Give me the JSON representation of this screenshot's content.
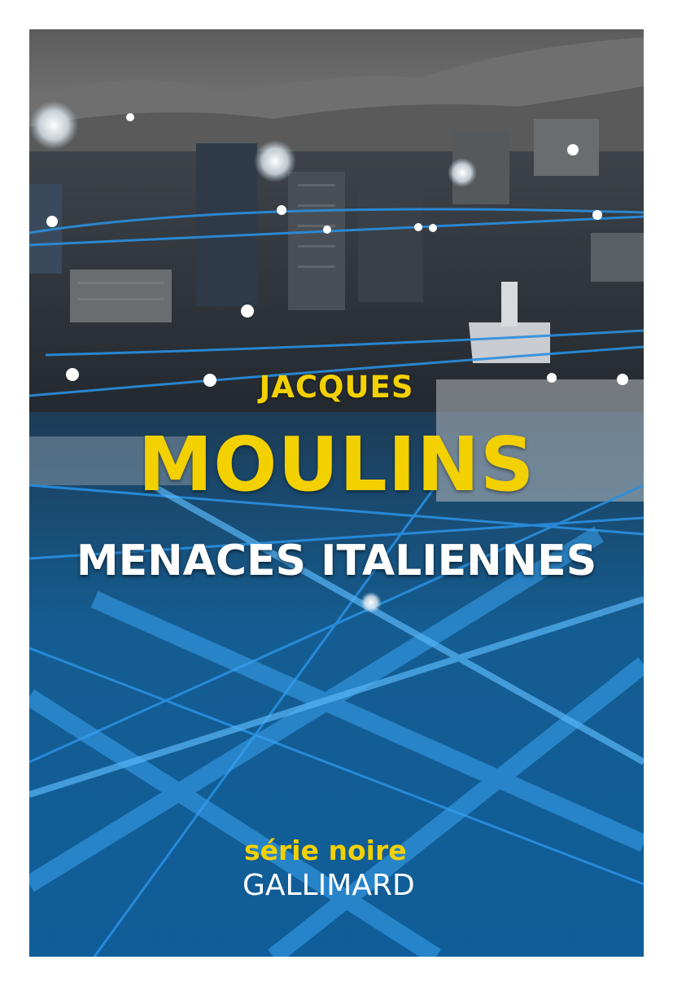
{
  "cover": {
    "author_first_name": "JACQUES",
    "author_last_name": "MOULINS",
    "title": "MENACES ITALIENNES",
    "series": "série noire",
    "publisher": "GALLIMARD"
  },
  "colors": {
    "accent_yellow": "#f3d000",
    "title_white": "#ffffff",
    "network_blue": "#2a8fe0",
    "deep_blue": "#0c4f86",
    "page_background": "#ffffff"
  }
}
